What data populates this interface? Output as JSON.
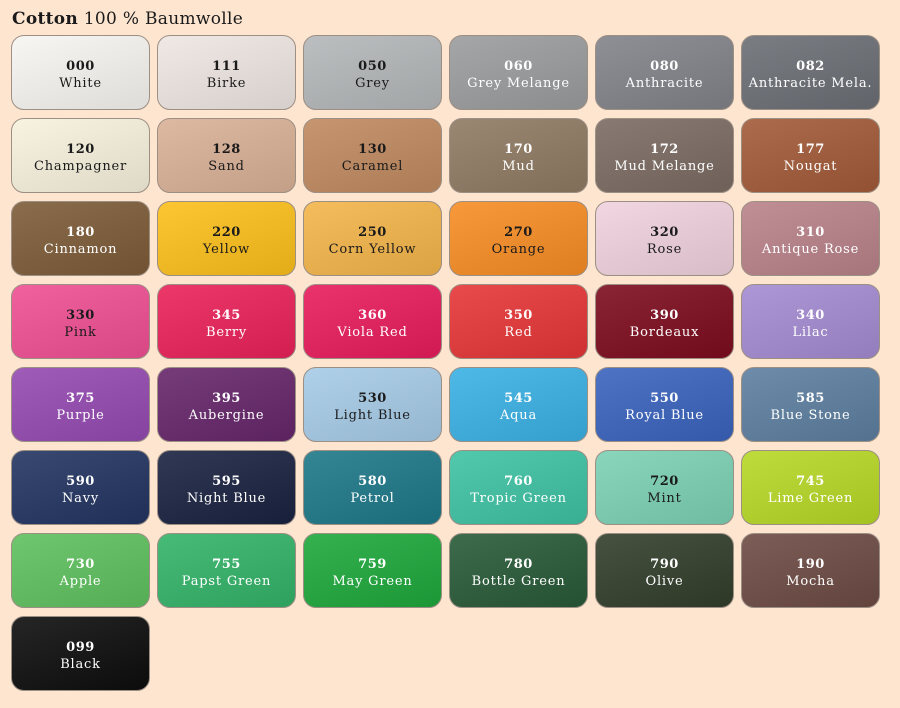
{
  "heading": {
    "brand": "Cotton",
    "material": "100 % Baumwolle"
  },
  "swatches": [
    {
      "code": "000",
      "name": "White",
      "color": "#f7f5f1",
      "text": "light"
    },
    {
      "code": "111",
      "name": "Birke",
      "color": "#efe6e2",
      "text": "light"
    },
    {
      "code": "050",
      "name": "Grey",
      "color": "#b4b7b9",
      "text": "light"
    },
    {
      "code": "060",
      "name": "Grey Melange",
      "color": "#9b9c9e",
      "text": "dark"
    },
    {
      "code": "080",
      "name": "Anthracite",
      "color": "#818389",
      "text": "dark"
    },
    {
      "code": "082",
      "name": "Anthracite Mela.",
      "color": "#6b6f75",
      "text": "dark"
    },
    {
      "code": "120",
      "name": "Champagner",
      "color": "#f7f2dd",
      "text": "light"
    },
    {
      "code": "128",
      "name": "Sand",
      "color": "#dab197",
      "text": "light"
    },
    {
      "code": "130",
      "name": "Caramel",
      "color": "#c08a60",
      "text": "light"
    },
    {
      "code": "170",
      "name": "Mud",
      "color": "#8f7a63",
      "text": "dark"
    },
    {
      "code": "172",
      "name": "Mud Melange",
      "color": "#7b6b62",
      "text": "dark"
    },
    {
      "code": "177",
      "name": "Nougat",
      "color": "#a25a38",
      "text": "dark"
    },
    {
      "code": "180",
      "name": "Cinnamon",
      "color": "#7d5c38",
      "text": "dark"
    },
    {
      "code": "220",
      "name": "Yellow",
      "color": "#fcc01c",
      "text": "light"
    },
    {
      "code": "250",
      "name": "Corn Yellow",
      "color": "#f4b54a",
      "text": "light"
    },
    {
      "code": "270",
      "name": "Orange",
      "color": "#f78d24",
      "text": "light"
    },
    {
      "code": "320",
      "name": "Rose",
      "color": "#f0d2df",
      "text": "light"
    },
    {
      "code": "310",
      "name": "Antique Rose",
      "color": "#b98289",
      "text": "dark"
    },
    {
      "code": "330",
      "name": "Pink",
      "color": "#ef4f93",
      "text": "light"
    },
    {
      "code": "345",
      "name": "Berry",
      "color": "#ea2159",
      "text": "dark"
    },
    {
      "code": "360",
      "name": "Viola Red",
      "color": "#e81c5c",
      "text": "dark"
    },
    {
      "code": "350",
      "name": "Red",
      "color": "#e63637",
      "text": "dark"
    },
    {
      "code": "390",
      "name": "Bordeaux",
      "color": "#7d0c1e",
      "text": "dark"
    },
    {
      "code": "340",
      "name": "Lilac",
      "color": "#a48bd1",
      "text": "dark"
    },
    {
      "code": "375",
      "name": "Purple",
      "color": "#944ab1",
      "text": "dark"
    },
    {
      "code": "395",
      "name": "Aubergine",
      "color": "#66266b",
      "text": "dark"
    },
    {
      "code": "530",
      "name": "Light Blue",
      "color": "#a6cbe6",
      "text": "light"
    },
    {
      "code": "545",
      "name": "Aqua",
      "color": "#3ab0e4",
      "text": "dark"
    },
    {
      "code": "550",
      "name": "Royal Blue",
      "color": "#3a63bd",
      "text": "dark"
    },
    {
      "code": "585",
      "name": "Blue Stone",
      "color": "#5d7fa0",
      "text": "dark"
    },
    {
      "code": "590",
      "name": "Navy",
      "color": "#233461",
      "text": "dark"
    },
    {
      "code": "595",
      "name": "Night Blue",
      "color": "#1a2241",
      "text": "dark"
    },
    {
      "code": "580",
      "name": "Petrol",
      "color": "#1e7888",
      "text": "dark"
    },
    {
      "code": "760",
      "name": "Tropic Green",
      "color": "#3ec2a3",
      "text": "dark"
    },
    {
      "code": "720",
      "name": "Mint",
      "color": "#7bd1b4",
      "text": "light"
    },
    {
      "code": "745",
      "name": "Lime Green",
      "color": "#b7d826",
      "text": "dark"
    },
    {
      "code": "730",
      "name": "Apple",
      "color": "#5ec05e",
      "text": "dark"
    },
    {
      "code": "755",
      "name": "Papst Green",
      "color": "#33b368",
      "text": "dark"
    },
    {
      "code": "759",
      "name": "May Green",
      "color": "#1ea83c",
      "text": "dark"
    },
    {
      "code": "780",
      "name": "Bottle Green",
      "color": "#285a37",
      "text": "dark"
    },
    {
      "code": "790",
      "name": "Olive",
      "color": "#323e2b",
      "text": "dark"
    },
    {
      "code": "190",
      "name": "Mocha",
      "color": "#6d4b44",
      "text": "dark"
    },
    {
      "code": "099",
      "name": "Black",
      "color": "#0d0d0d",
      "text": "dark"
    }
  ]
}
